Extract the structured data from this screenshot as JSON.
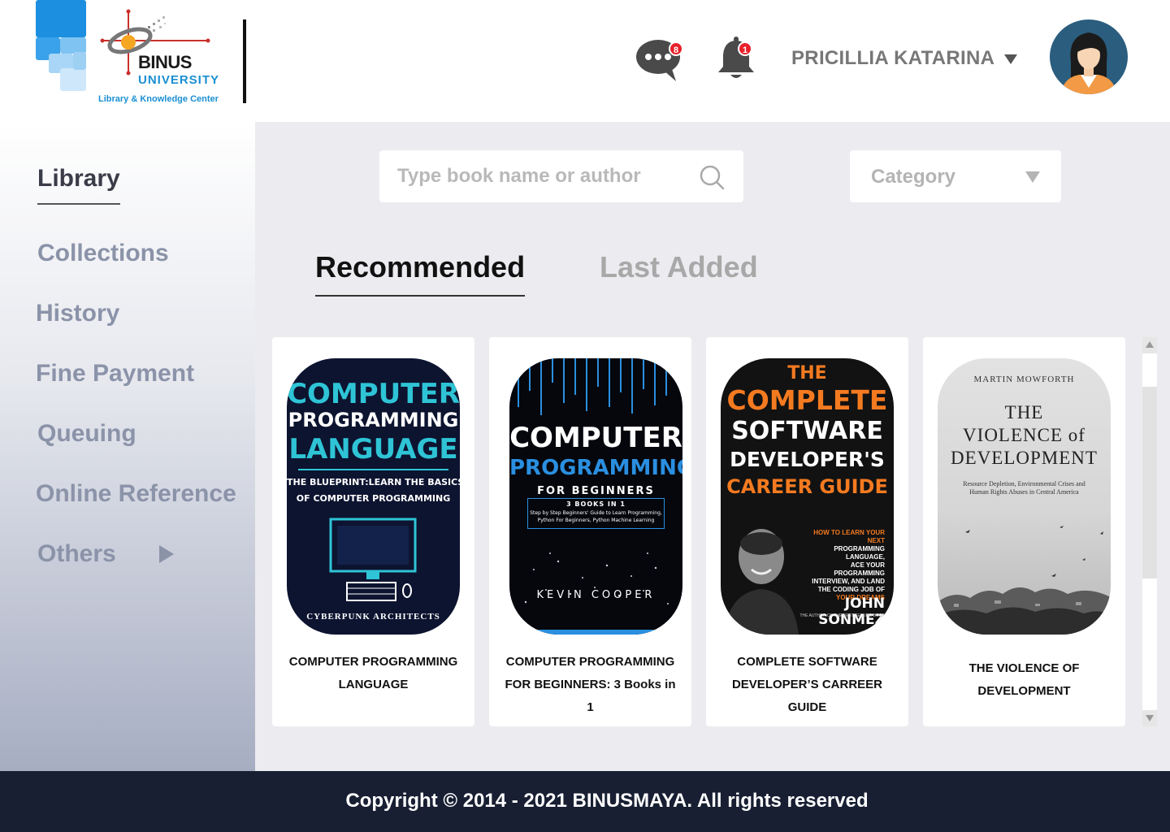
{
  "header": {
    "logo": {
      "brand": "BINUS",
      "university": "UNIVERSITY",
      "subtitle": "Library & Knowledge Center"
    },
    "notifications": {
      "messages_count": "8",
      "alerts_count": "1"
    },
    "user": {
      "name": "PRICILLIA KATARINA"
    }
  },
  "sidebar": {
    "items": [
      {
        "label": "Library",
        "active": true
      },
      {
        "label": "Collections"
      },
      {
        "label": "History"
      },
      {
        "label": "Fine Payment"
      },
      {
        "label": "Queuing"
      },
      {
        "label": "Online Reference"
      },
      {
        "label": "Others"
      }
    ]
  },
  "search": {
    "placeholder": "Type book name or author",
    "value": ""
  },
  "category": {
    "label": "Category"
  },
  "tabs": [
    {
      "label": "Recommended",
      "active": true
    },
    {
      "label": "Last Added"
    }
  ],
  "books": [
    {
      "title": "COMPUTER PROGRAMMING LANGUAGE",
      "cover": {
        "l1": "COMPUTER",
        "l2": "PROGRAMMING",
        "l3": "LANGUAGE",
        "l4": "THE BLUEPRINT:LEARN THE BASICS",
        "l5": "OF COMPUTER PROGRAMMING",
        "author": "CYBERPUNK ARCHITECTS"
      }
    },
    {
      "title": "COMPUTER PROGRAMMING FOR BEGINNERS: 3 Books in 1",
      "cover": {
        "l1": "COMPUTER",
        "l2": "PROGRAMMING",
        "l3": "FOR BEGINNERS",
        "l4": "3 BOOKS IN 1",
        "l5": "Step by Step Beginners' Guide to Learn Programming,",
        "l6": "Python For Beginners, Python Machine Learning",
        "author": "KEVIN COOPER"
      }
    },
    {
      "title": "COMPLETE SOFTWARE DEVELOPER’S CARREER GUIDE",
      "cover": {
        "l1": "THE",
        "l2": "COMPLETE",
        "l3": "SOFTWARE",
        "l4": "DEVELOPER'S",
        "l5": "CAREER GUIDE",
        "t1": "HOW TO LEARN YOUR NEXT",
        "t2": "PROGRAMMING LANGUAGE,",
        "t3": "ACE YOUR PROGRAMMING",
        "t4": "INTERVIEW, AND LAND",
        "t5": "THE CODING JOB OF",
        "t6": "YOUR DREAMS",
        "author": "JOHN SONMEZ",
        "byline": "THE AUTHOR OF THE BEST SELLING BOOK"
      }
    },
    {
      "title": "THE VIOLENCE OF DEVELOPMENT",
      "cover": {
        "author": "MARTIN MOWFORTH",
        "l1": "THE",
        "l2": "VIOLENCE of",
        "l3": "DEVELOPMENT",
        "s1": "Resource Depletion, Environmental Crises and",
        "s2": "Human Rights Abuses in Central America"
      }
    }
  ],
  "footer": {
    "copyright": "Copyright © 2014 - 2021 BINUSMAYA. All rights reserved"
  },
  "colors": {
    "footer_bg": "#181f33",
    "badge": "#e8202a",
    "accent_blue": "#1a8fd1",
    "main_bg": "#ecebef"
  }
}
